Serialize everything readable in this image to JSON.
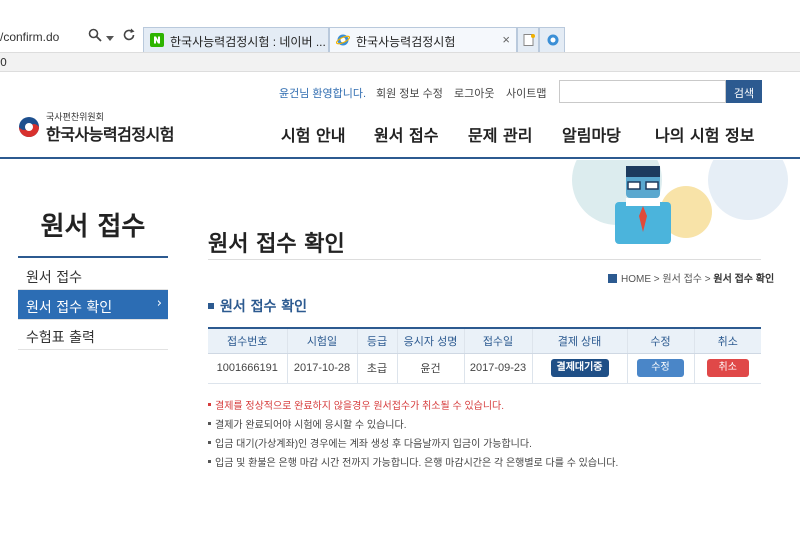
{
  "browser": {
    "address_text": "/confirm.do",
    "status_text": "0",
    "tabs": [
      {
        "title": "한국사능력검정시험 : 네이버 ..."
      },
      {
        "title": "한국사능력검정시험"
      }
    ],
    "close_glyph": "×"
  },
  "topbar": {
    "welcome": "윤건님 환영합니다.",
    "links": [
      "회원 정보 수정",
      "로그아웃",
      "사이트맵"
    ],
    "search_placeholder": "",
    "search_button": "검색"
  },
  "logo": {
    "sub": "국사편찬위원회",
    "main": "한국사능력검정시험"
  },
  "gnb": [
    "시험 안내",
    "원서 접수",
    "문제 관리",
    "알림마당",
    "나의 시험 정보"
  ],
  "lnb": {
    "title": "원서 접수",
    "items": [
      {
        "label": "원서 접수",
        "active": false
      },
      {
        "label": "원서 접수 확인",
        "active": true
      },
      {
        "label": "수험표 출력",
        "active": false
      }
    ],
    "active_arrow": "›"
  },
  "content": {
    "page_title": "원서 접수 확인",
    "breadcrumb": [
      "HOME",
      "원서 접수",
      "원서 접수 확인"
    ],
    "section_title": "원서 접수 확인",
    "table": {
      "headers": [
        "접수번호",
        "시험일",
        "등급",
        "응시자 성명",
        "접수일",
        "결제 상태",
        "수정",
        "취소"
      ],
      "row": {
        "receipt_no": "1001666191",
        "exam_date": "2017-10-28",
        "grade": "초급",
        "name": "윤건",
        "receipt_date": "2017-09-23",
        "pay_status": "결제대기중",
        "edit_label": "수정",
        "cancel_label": "취소"
      }
    },
    "notes": [
      "결제를 정상적으로 완료하지 않을경우 원서접수가 취소될 수 있습니다.",
      "결제가 완료되어야 시험에 응시할 수 있습니다.",
      "입금 대기(가상계좌)인 경우에는 계좌 생성 후 다음날까지 입금이 가능합니다.",
      "입금 및 환불은 은행 마감 시간 전까지 가능합니다. 은행 마감시간은 각 은행별로 다를 수 있습니다."
    ]
  },
  "colors": {
    "brand": "#2c5a90",
    "active_nav": "#2c6db4",
    "cancel": "#e04848",
    "warning_text": "#d63c3c"
  }
}
